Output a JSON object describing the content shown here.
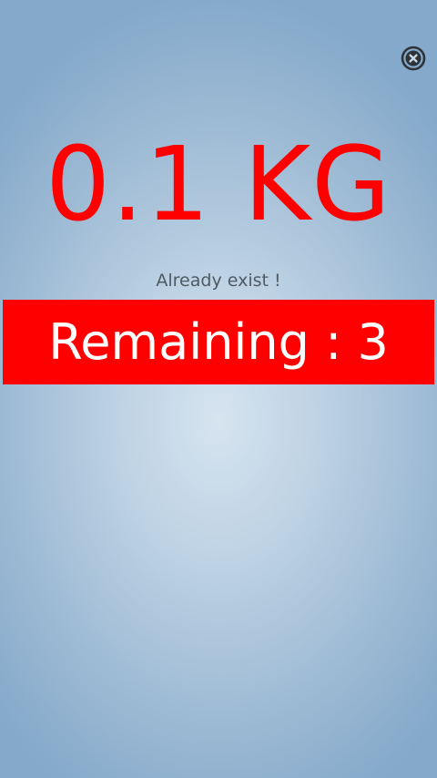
{
  "weight": {
    "text": "0.1 KG"
  },
  "status": {
    "text": "Already exist !"
  },
  "remaining": {
    "text": "Remaining : 3"
  },
  "icons": {
    "close": "close-circle-icon"
  },
  "colors": {
    "accent": "#ff0000",
    "background_center": "#d6e4ef",
    "background_edge": "#84a9ca",
    "status_text": "#4e5a64",
    "remaining_text": "#ffffff"
  }
}
